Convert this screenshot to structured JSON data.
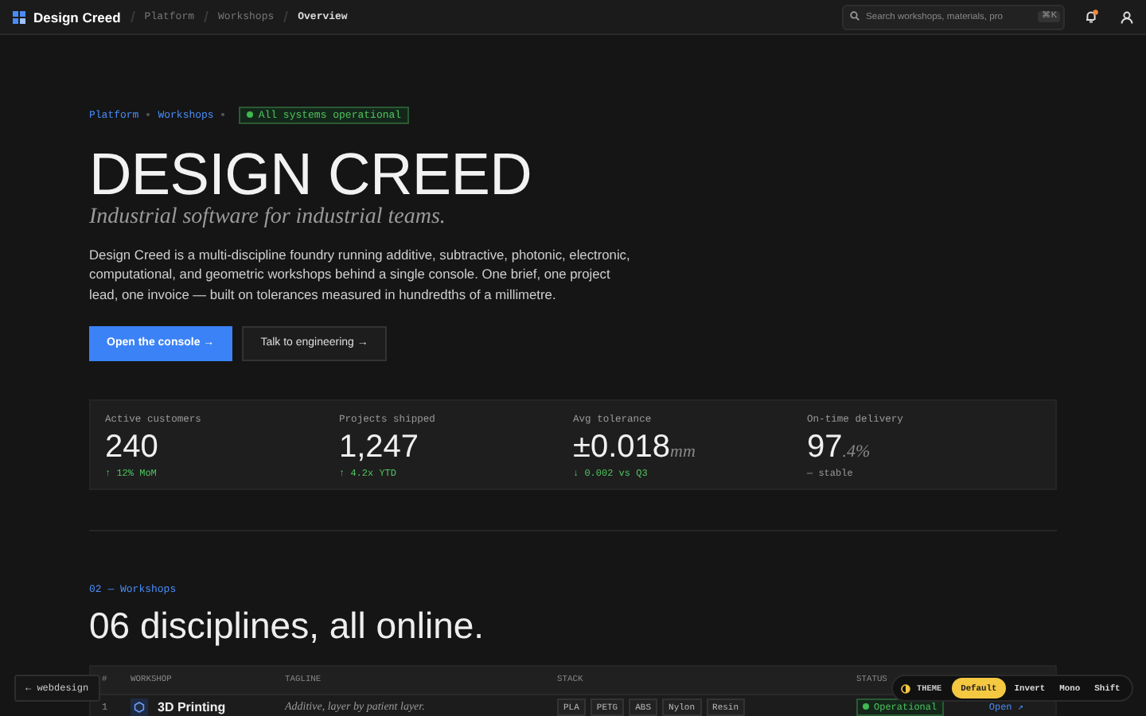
{
  "topbar": {
    "brand": "Design Creed",
    "breadcrumbs": [
      {
        "label": "Platform",
        "selected": false
      },
      {
        "label": "Workshops",
        "selected": false
      },
      {
        "label": "Overview",
        "selected": true
      }
    ],
    "search": {
      "placeholder": "Search workshops, materials, pro",
      "shortcut": "⌘K"
    },
    "notifications": {
      "unread": true
    }
  },
  "hero": {
    "crumbs": [
      "Platform",
      "Workshops"
    ],
    "status": {
      "label": "All systems operational",
      "color": "#3fb950"
    },
    "title": "DESIGN CREED",
    "subtitle": "Industrial software for industrial teams.",
    "body": "Design Creed is a multi-discipline foundry running additive, subtractive, photonic, electronic, computational, and geometric workshops behind a single console. One brief, one project lead, one invoice — built on tolerances measured in hundredths of a millimetre.",
    "buttons": [
      {
        "label": "Open the console →",
        "kind": "primary"
      },
      {
        "label": "Talk to engineering →",
        "kind": "secondary"
      }
    ]
  },
  "stats": [
    {
      "label": "Active customers",
      "value": "240",
      "delta": "↑ 12% MoM",
      "color": "#4fc35f"
    },
    {
      "label": "Projects shipped",
      "value": "1,247",
      "delta": "↑ 4.2x YTD",
      "color": "#4fc35f"
    },
    {
      "label": "Avg tolerance",
      "value": "±0.018",
      "unit": "mm",
      "delta": "↓ 0.002 vs Q3",
      "color": "#4fc35f"
    },
    {
      "label": "On-time delivery",
      "value": "97",
      "unit": ".4%",
      "delta": "— stable",
      "color": "#999999"
    }
  ],
  "workshops": {
    "eyebrow": "02 — Workshops",
    "heading": "06 disciplines, all online.",
    "table": {
      "columns": [
        "#",
        "WORKSHOP",
        "TAGLINE",
        "STACK",
        "STATUS"
      ],
      "rows": [
        {
          "index": "1",
          "name": "3D Printing",
          "tagline": "Additive, layer by patient layer.",
          "stack": [
            "PLA",
            "PETG",
            "ABS",
            "Nylon",
            "Resin"
          ],
          "status": {
            "label": "Operational",
            "color": "#3fb950"
          },
          "action": "Open ↗"
        }
      ]
    }
  },
  "theme_switcher": {
    "label": "THEME",
    "options": [
      {
        "label": "Default",
        "selected": true
      },
      {
        "label": "Invert",
        "selected": false
      },
      {
        "label": "Mono",
        "selected": false
      },
      {
        "label": "Shift",
        "selected": false
      }
    ]
  },
  "back_link": "← webdesign"
}
